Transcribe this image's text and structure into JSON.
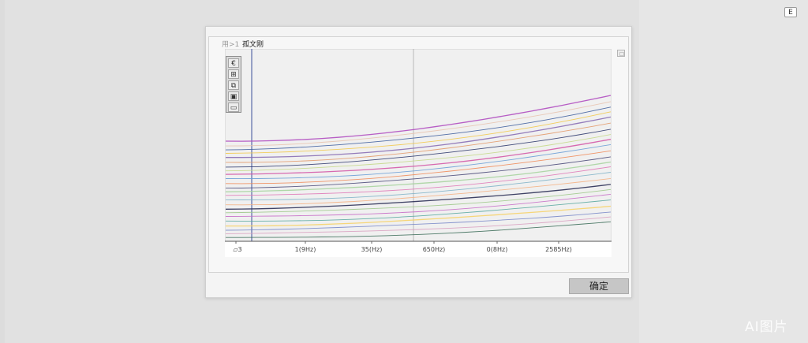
{
  "corner_button": {
    "label": "E"
  },
  "tab": {
    "prefix": "用>1",
    "title": "孤文刚"
  },
  "toolbox": {
    "tools": [
      {
        "icon": "euro-icon",
        "glyph": "€"
      },
      {
        "icon": "layout-icon",
        "glyph": "⊞"
      },
      {
        "icon": "stack-icon",
        "glyph": "⧉"
      },
      {
        "icon": "chart-icon",
        "glyph": "▣"
      },
      {
        "icon": "frame-icon",
        "glyph": "▭"
      }
    ]
  },
  "chart_data": {
    "type": "line",
    "x_tick_labels": [
      "▱3",
      "1(9Hz)",
      "35(Hz)",
      "650Hz)",
      "0(8Hz)",
      "2585Hz)"
    ],
    "series_colors": [
      "#b04cc0",
      "#e8c4b0",
      "#3f5f9f",
      "#f2c94c",
      "#8a6fb5",
      "#e39a6a",
      "#2f3a6e",
      "#c5d98a",
      "#d45aa8",
      "#6b9fd6",
      "#f08c5a",
      "#4b4b7a",
      "#a8d4a0",
      "#e07ab8",
      "#7fb3c8",
      "#f4b183",
      "#2b2f55",
      "#9ec98a",
      "#c86fc8",
      "#5aa9a0",
      "#f6d36b",
      "#7a8ac9",
      "#d9a0c0",
      "#3d6e5a"
    ]
  },
  "primary_button": {
    "label": "确定"
  },
  "watermark": {
    "text": "AI图片"
  }
}
